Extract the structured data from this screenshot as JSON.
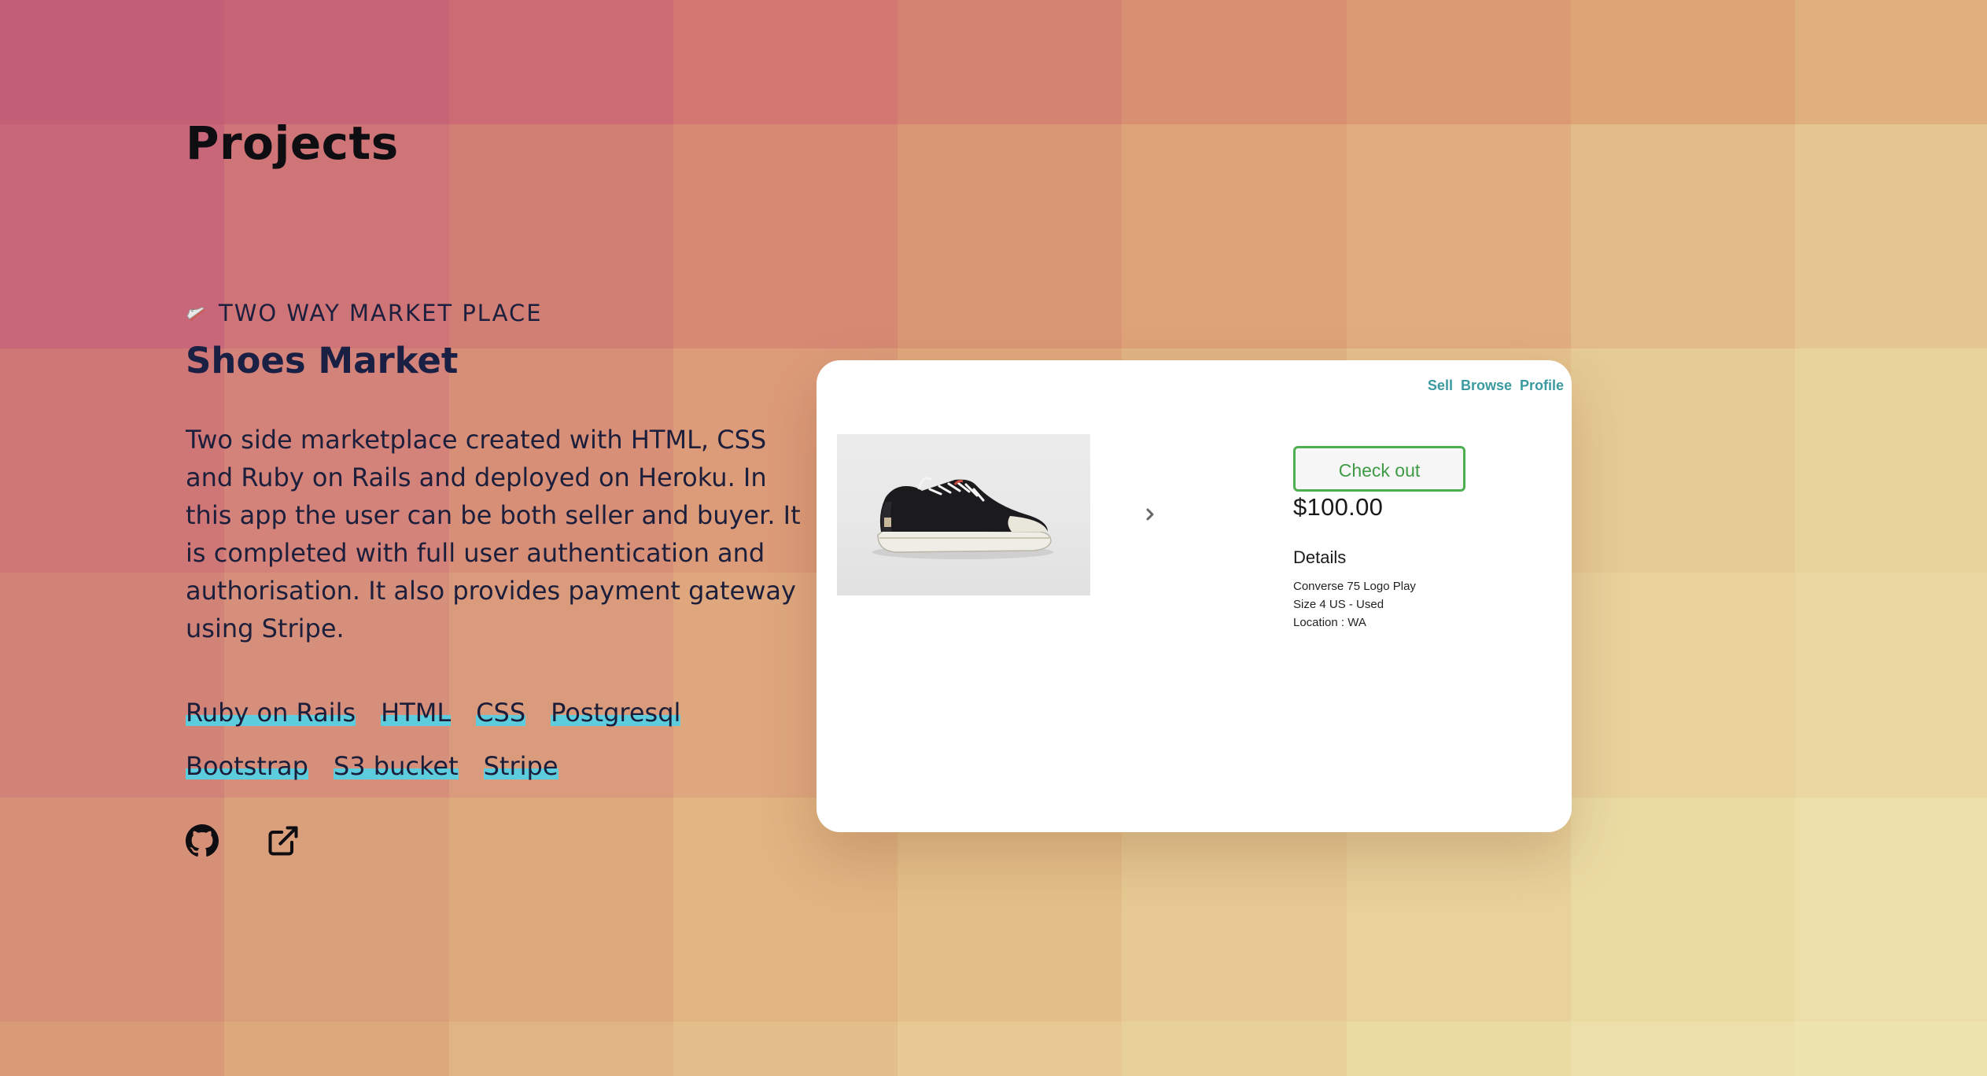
{
  "page": {
    "title": "Projects"
  },
  "background": {
    "tiles": [
      [
        "#c35e77",
        "#c76475",
        "#cc6b73",
        "#d27771",
        "#d58371",
        "#d98f72",
        "#dc9a74",
        "#dea475",
        "#e0af7e",
        "#e3bf8a"
      ],
      [
        "#c8667a",
        "#cf7577",
        "#d17f74",
        "#d68a74",
        "#da9775",
        "#dea378",
        "#e1ad7f",
        "#e3ba89",
        "#e5c592",
        "#e8d09c"
      ],
      [
        "#cf7676",
        "#d3837a",
        "#d88f78",
        "#dc9b79",
        "#dfa97d",
        "#e2b584",
        "#e4c18d",
        "#e6cb95",
        "#e8d39d",
        "#ead9a3"
      ],
      [
        "#d28378",
        "#d68f7b",
        "#da9a7c",
        "#dea77e",
        "#e1b384",
        "#e4bf8b",
        "#e6c994",
        "#e8d19b",
        "#ead7a1",
        "#ebdda8"
      ],
      [
        "#d69077",
        "#daa07b",
        "#dea97d",
        "#e1b482",
        "#e4bf89",
        "#e6c993",
        "#e8d19a",
        "#eadba3",
        "#ecdfa9",
        "#ede3ae"
      ],
      [
        "#d99a78",
        "#dda97c",
        "#e1b583",
        "#e3c08b",
        "#e6c993",
        "#e8d09b",
        "#eadba3",
        "#ecdfa9",
        "#ede4af",
        "#efe9b6"
      ]
    ]
  },
  "project": {
    "kicker": "TWO WAY MARKET PLACE",
    "kicker_icon": "shoe-icon",
    "title": "Shoes Market",
    "description": "Two side marketplace created with HTML, CSS and Ruby on Rails and deployed on Heroku. In this app the user can be both seller and buyer. It is completed with full user authentication and authorisation. It also provides payment gateway using Stripe.",
    "tags": [
      "Ruby on Rails",
      "HTML",
      "CSS",
      "Postgresql",
      "Bootstrap",
      "S3 bucket",
      "Stripe"
    ],
    "tag_underline_color": "#5dcdde",
    "links": [
      {
        "icon": "github-icon"
      },
      {
        "icon": "external-link-icon"
      }
    ]
  },
  "preview": {
    "nav": [
      "Sell",
      "Browse",
      "Profile"
    ],
    "checkout_label": "Check out",
    "price": "$100.00",
    "details_heading": "Details",
    "details": [
      "Converse 75 Logo Play",
      "Size 4 US - Used",
      "Location : WA"
    ],
    "accent_color": "#4caf50"
  }
}
